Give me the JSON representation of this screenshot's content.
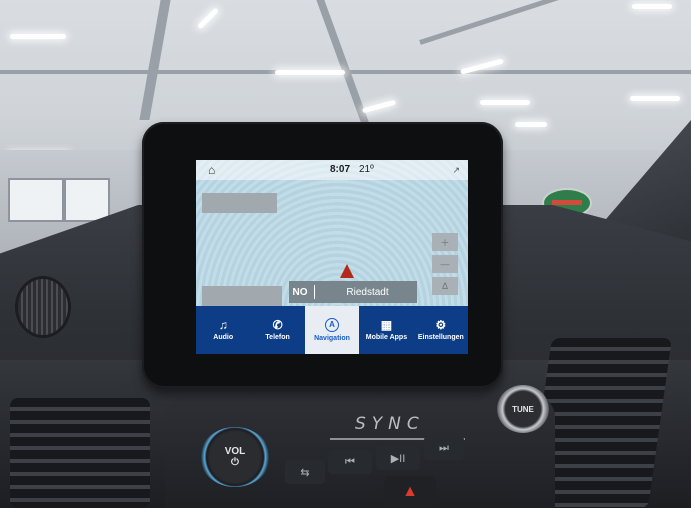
{
  "status_bar": {
    "home_icon": "⌂",
    "time": "8:07",
    "temperature": "21º",
    "compass_icon": "↗"
  },
  "map": {
    "street_direction": "NO",
    "street_name": "Riedstadt",
    "zoom_in_icon": "＋",
    "zoom_out_icon": "—",
    "north_icon": "Δ"
  },
  "nav": {
    "items": [
      {
        "label": "Audio",
        "icon": "♫"
      },
      {
        "label": "Telefon",
        "icon": "✆"
      },
      {
        "label": "Navigation",
        "icon": "A"
      },
      {
        "label": "Mobile Apps",
        "icon": "▦"
      },
      {
        "label": "Einstellungen",
        "icon": "⚙"
      }
    ],
    "active": "Navigation"
  },
  "console": {
    "logo": "SYNC",
    "vol_label": "VOL",
    "power_icon": "⏻",
    "tune_label": "TUNE",
    "prev_icon": "⏮",
    "play_pause_icon": "▶II",
    "next_icon": "⏭",
    "eq_icon": "⇆",
    "hazard_icon": "▲"
  },
  "colors": {
    "nav_bar": "#0d3d86",
    "nav_active_text": "#1a5cc7",
    "vol_ring": "#5aa7d8",
    "hazard": "#d93a2b"
  }
}
